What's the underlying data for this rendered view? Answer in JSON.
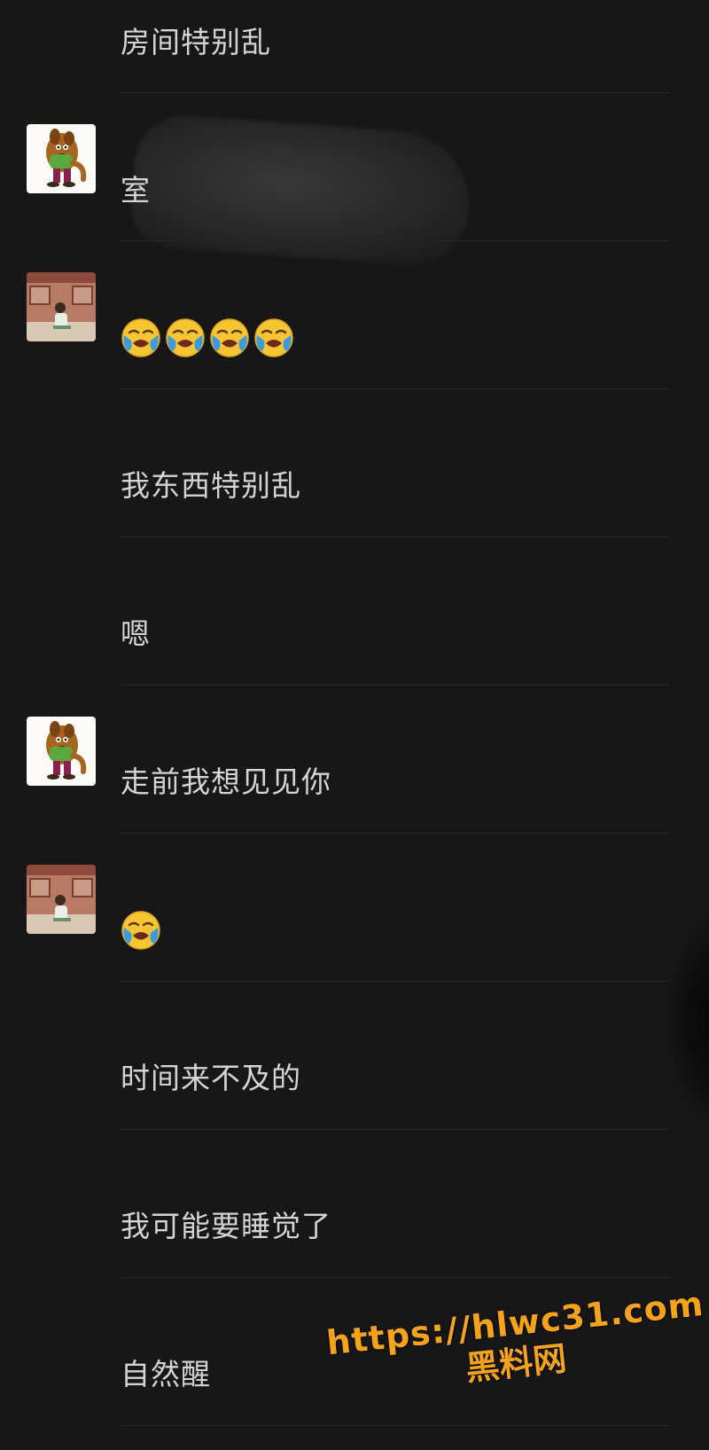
{
  "messages": [
    {
      "text": "房间特别乱"
    },
    {
      "text": "室",
      "avatar": "scooby-doo-avatar"
    },
    {
      "emoji": "loudly-crying-face",
      "count": 4,
      "avatar": "anime-room-avatar"
    },
    {
      "text": "我东西特别乱"
    },
    {
      "text": "嗯"
    },
    {
      "text": "走前我想见见你",
      "avatar": "scooby-doo-avatar"
    },
    {
      "emoji": "loudly-crying-face",
      "count": 1,
      "avatar": "anime-room-avatar"
    },
    {
      "text": "时间来不及的"
    },
    {
      "text": "我可能要睡觉了"
    },
    {
      "text": "自然醒"
    }
  ],
  "watermark": {
    "url": "https://hlwc31.com",
    "site": "黑料网"
  },
  "colors": {
    "background": "#171717",
    "text": "#d4d4d4",
    "divider": "#262626",
    "watermark": "#f5a31a"
  }
}
